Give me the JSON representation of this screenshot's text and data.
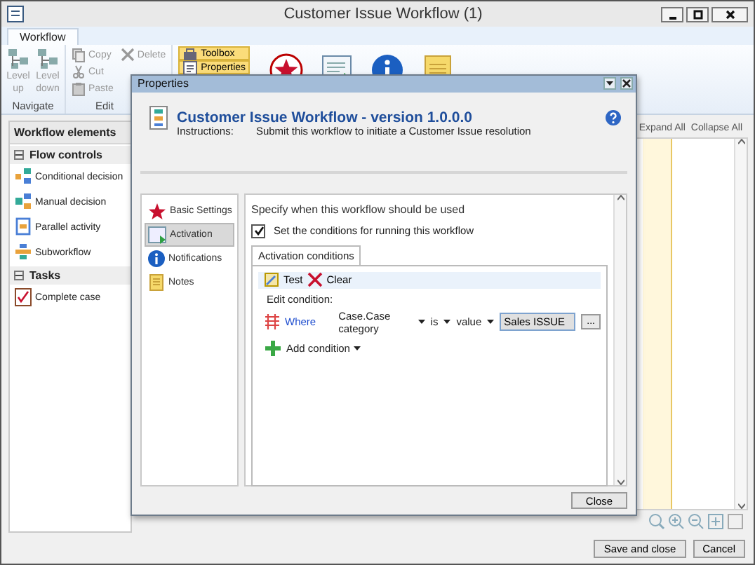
{
  "window": {
    "title": "Customer Issue Workflow (1)"
  },
  "ribbon": {
    "tabs": [
      {
        "label": "Workflow",
        "selected": true
      }
    ],
    "groups": [
      {
        "name": "Navigate",
        "buttons": [
          {
            "label": "Level up",
            "disabled": true
          },
          {
            "label": "Level down",
            "disabled": true
          }
        ]
      },
      {
        "name": "Edit",
        "buttons": [
          {
            "label": "Copy",
            "disabled": true
          },
          {
            "label": "Delete",
            "disabled": true
          },
          {
            "label": "Cut",
            "disabled": true
          },
          {
            "label": "Paste",
            "disabled": true
          }
        ]
      }
    ],
    "toggles": [
      {
        "label": "Toolbox",
        "selected": true
      },
      {
        "label": "Properties",
        "selected": true
      }
    ]
  },
  "toolbox": {
    "title": "Workflow elements",
    "groups": [
      {
        "label": "Flow controls",
        "expanded": true,
        "items": [
          "Conditional decision",
          "Manual decision",
          "Parallel activity",
          "Subworkflow"
        ]
      },
      {
        "label": "Tasks",
        "expanded": true,
        "items": [
          "Complete case"
        ]
      }
    ]
  },
  "canvas": {
    "links": [
      "Expand All",
      "Collapse All"
    ]
  },
  "footer": {
    "buttons": [
      "Save and close",
      "Cancel"
    ]
  },
  "dialog": {
    "title": "Properties",
    "heading": "Customer Issue Workflow - version 1.0.0.0",
    "instructions_label": "Instructions:",
    "instructions": "Submit this workflow to initiate a Customer Issue resolution",
    "nav": [
      {
        "label": "Basic Settings",
        "selected": false
      },
      {
        "label": "Activation",
        "selected": true
      },
      {
        "label": "Notifications",
        "selected": false
      },
      {
        "label": "Notes",
        "selected": false
      }
    ],
    "prompt": "Specify when this workflow should be used",
    "condition_checkbox": {
      "label": "Set the conditions for running this workflow",
      "checked": true
    },
    "tabs": [
      {
        "label": "Activation conditions",
        "selected": true
      }
    ],
    "toolbar": [
      "Test",
      "Clear"
    ],
    "edit_label": "Edit condition:",
    "condition": {
      "where": "Where",
      "field": "Case.Case category",
      "operator": "is",
      "type": "value",
      "value": "Sales ISSUE",
      "browse": "..."
    },
    "add": "Add condition",
    "close": "Close"
  }
}
